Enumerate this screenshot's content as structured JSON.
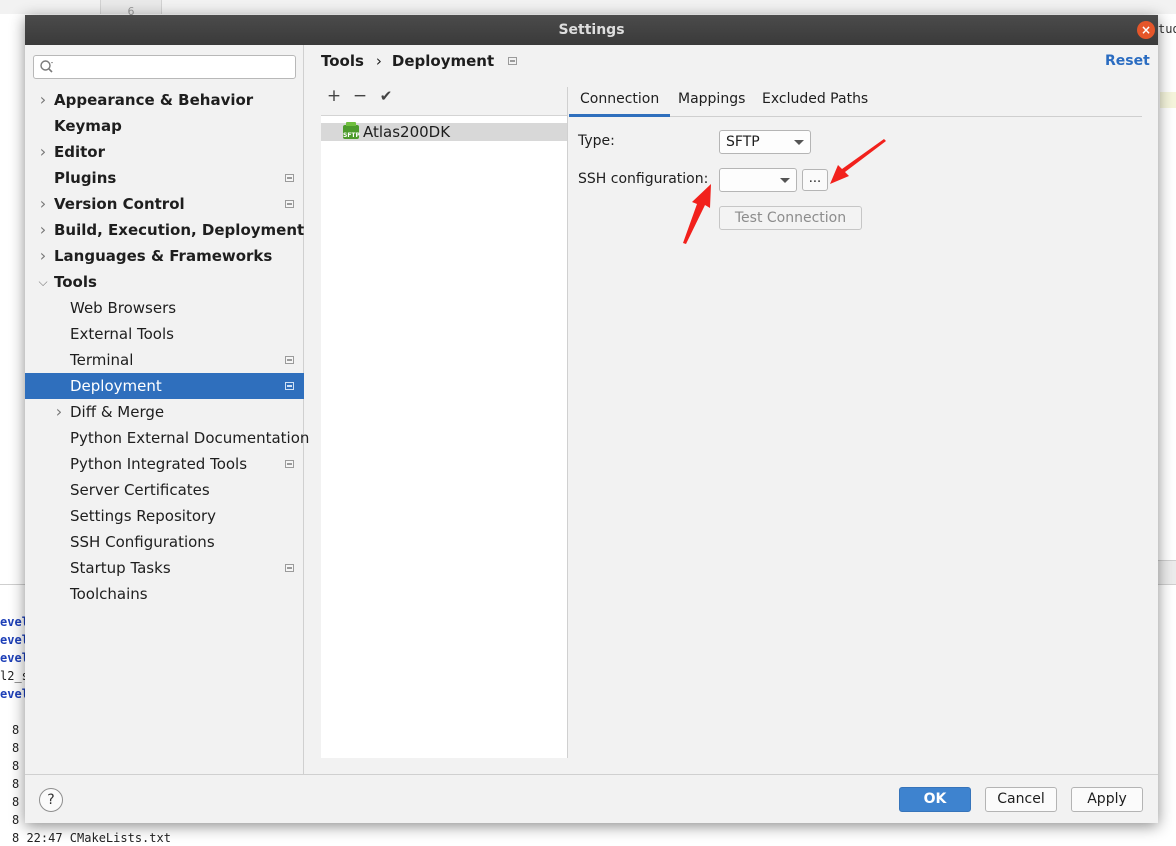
{
  "background": {
    "gutter_number": "6",
    "right_text": "tud",
    "console_lines": [
      {
        "text": "evel",
        "style": "blue"
      },
      {
        "text": "evel",
        "style": "blue"
      },
      {
        "text": "evel",
        "style": "blue"
      },
      {
        "text": "l2_s",
        "style": "dark"
      },
      {
        "text": "evel",
        "style": "blue"
      },
      {
        "text": "",
        "style": "dark"
      },
      {
        "text": "8",
        "style": "dark"
      },
      {
        "text": "8",
        "style": "dark"
      },
      {
        "text": "8",
        "style": "dark"
      },
      {
        "text": "8",
        "style": "dark"
      },
      {
        "text": "8",
        "style": "dark"
      },
      {
        "text": "8",
        "style": "dark"
      },
      {
        "text": "8 22:47 CMakeLists.txt",
        "style": "dark"
      }
    ]
  },
  "dialog": {
    "title": "Settings",
    "close_glyph": "×"
  },
  "search": {
    "placeholder": "",
    "icon": "search-icon"
  },
  "sidebar": {
    "items": [
      {
        "label": "Appearance & Behavior",
        "bold": true,
        "chevron": "right",
        "indent": 0,
        "badge": false,
        "selected": false
      },
      {
        "label": "Keymap",
        "bold": true,
        "chevron": "",
        "indent": 0,
        "badge": false,
        "selected": false
      },
      {
        "label": "Editor",
        "bold": true,
        "chevron": "right",
        "indent": 0,
        "badge": false,
        "selected": false
      },
      {
        "label": "Plugins",
        "bold": true,
        "chevron": "",
        "indent": 0,
        "badge": true,
        "selected": false
      },
      {
        "label": "Version Control",
        "bold": true,
        "chevron": "right",
        "indent": 0,
        "badge": true,
        "selected": false
      },
      {
        "label": "Build, Execution, Deployment",
        "bold": true,
        "chevron": "right",
        "indent": 0,
        "badge": false,
        "selected": false
      },
      {
        "label": "Languages & Frameworks",
        "bold": true,
        "chevron": "right",
        "indent": 0,
        "badge": false,
        "selected": false
      },
      {
        "label": "Tools",
        "bold": true,
        "chevron": "down",
        "indent": 0,
        "badge": false,
        "selected": false
      },
      {
        "label": "Web Browsers",
        "bold": false,
        "chevron": "",
        "indent": 1,
        "badge": false,
        "selected": false
      },
      {
        "label": "External Tools",
        "bold": false,
        "chevron": "",
        "indent": 1,
        "badge": false,
        "selected": false
      },
      {
        "label": "Terminal",
        "bold": false,
        "chevron": "",
        "indent": 1,
        "badge": true,
        "selected": false
      },
      {
        "label": "Deployment",
        "bold": false,
        "chevron": "",
        "indent": 1,
        "badge": true,
        "selected": true
      },
      {
        "label": "Diff & Merge",
        "bold": false,
        "chevron": "right",
        "indent": 1,
        "badge": false,
        "selected": false
      },
      {
        "label": "Python External Documentation",
        "bold": false,
        "chevron": "",
        "indent": 1,
        "badge": false,
        "selected": false
      },
      {
        "label": "Python Integrated Tools",
        "bold": false,
        "chevron": "",
        "indent": 1,
        "badge": true,
        "selected": false
      },
      {
        "label": "Server Certificates",
        "bold": false,
        "chevron": "",
        "indent": 1,
        "badge": false,
        "selected": false
      },
      {
        "label": "Settings Repository",
        "bold": false,
        "chevron": "",
        "indent": 1,
        "badge": false,
        "selected": false
      },
      {
        "label": "SSH Configurations",
        "bold": false,
        "chevron": "",
        "indent": 1,
        "badge": false,
        "selected": false
      },
      {
        "label": "Startup Tasks",
        "bold": false,
        "chevron": "",
        "indent": 1,
        "badge": true,
        "selected": false
      },
      {
        "label": "Toolchains",
        "bold": false,
        "chevron": "",
        "indent": 1,
        "badge": false,
        "selected": false
      }
    ]
  },
  "breadcrumb": {
    "parent": "Tools",
    "separator": "›",
    "current": "Deployment"
  },
  "reset_label": "Reset",
  "toolbar": {
    "add": "+",
    "remove": "−",
    "apply": "✔"
  },
  "servers": [
    {
      "name": "Atlas200DK",
      "icon": "sftp-server-icon",
      "icon_text": "SFTP"
    }
  ],
  "tabs": [
    {
      "label": "Connection",
      "active": true
    },
    {
      "label": "Mappings",
      "active": false
    },
    {
      "label": "Excluded Paths",
      "active": false
    }
  ],
  "form": {
    "type_label": "Type:",
    "type_value": "SFTP",
    "ssh_label": "SSH configuration:",
    "ssh_value": "",
    "browse_label": "...",
    "test_connection": "Test Connection"
  },
  "annotation_color": "#f2211c",
  "footer": {
    "help": "?",
    "ok": "OK",
    "cancel": "Cancel",
    "apply": "Apply"
  },
  "colors": {
    "accent": "#2f6fbd",
    "link": "#2a6cc1",
    "primary_button": "#3e83cf"
  }
}
